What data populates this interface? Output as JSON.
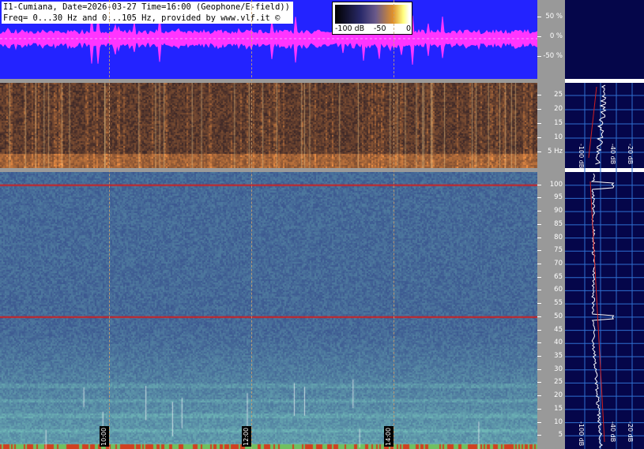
{
  "header": {
    "line1": "I1-Cumiana, Date=2026-03-27 Time=16:00 (Geophone/E-field))",
    "line2": "Freq= 0...30 Hz and 0...105 Hz, provided by www.vlf.it ©"
  },
  "color_scale": {
    "min_label": "-100 dB",
    "mid_label": "-50",
    "max_label": "0"
  },
  "colors": {
    "waveform_bg": "#2323ff",
    "waveform_trace": "#ff35ff",
    "panel_bg": "#05064a",
    "axis_bar": "#999999",
    "marker_line": "#d02020"
  },
  "chart_data": [
    {
      "type": "line",
      "name": "waveform",
      "ylabel_ticks": [
        "50 %",
        "0 %",
        "-50 %"
      ],
      "ylim": [
        -100,
        100
      ]
    },
    {
      "type": "heatmap",
      "name": "spectrogram-0-30hz",
      "y_ticks": [
        "25",
        "20",
        "15",
        "10",
        "5 Hz"
      ],
      "ylim": [
        0,
        30
      ],
      "side_labels": [
        "-100 dB",
        "-40 dB",
        "-20 dB"
      ]
    },
    {
      "type": "heatmap",
      "name": "spectrogram-0-105hz",
      "y_ticks": [
        "100",
        "95",
        "90",
        "85",
        "80",
        "75",
        "70",
        "65",
        "60",
        "55",
        "50",
        "45",
        "40",
        "35",
        "30",
        "25",
        "20",
        "15",
        "10",
        "5"
      ],
      "ylim": [
        0,
        105
      ],
      "x_time_labels": [
        "10:00",
        "12:00",
        "14:00"
      ],
      "side_labels": [
        "-100 dB",
        "-40 dB",
        "-20 dB"
      ],
      "marker_lines_hz": [
        100,
        50
      ]
    }
  ]
}
